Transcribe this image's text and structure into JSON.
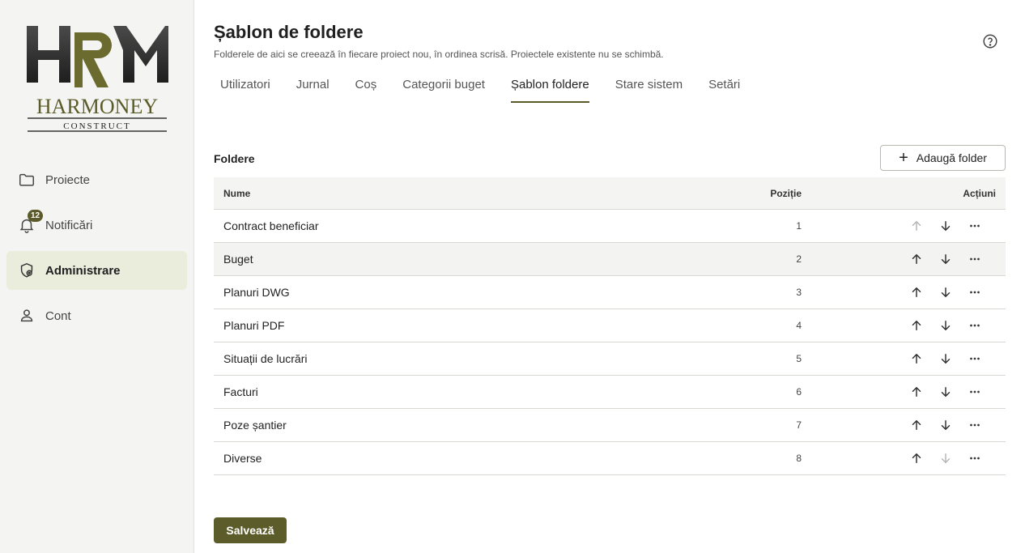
{
  "brand": {
    "logo_text": "HRM",
    "name": "HARMONEY",
    "tagline": "CONSTRUCT",
    "accent_color": "#5c5c2a"
  },
  "sidebar": {
    "items": [
      {
        "label": "Proiecte",
        "icon": "folder-icon",
        "active": false
      },
      {
        "label": "Notificări",
        "icon": "bell-icon",
        "badge": "12",
        "active": false
      },
      {
        "label": "Administrare",
        "icon": "shield-gear-icon",
        "active": true
      },
      {
        "label": "Cont",
        "icon": "user-icon",
        "active": false
      }
    ]
  },
  "header": {
    "title": "Șablon de foldere",
    "subtitle": "Folderele de aici se creează în fiecare proiect nou, în ordinea scrisă. Proiectele existente nu se schimbă.",
    "help_icon": "help-icon"
  },
  "tabs": [
    {
      "label": "Utilizatori",
      "active": false
    },
    {
      "label": "Jurnal",
      "active": false
    },
    {
      "label": "Coș",
      "active": false
    },
    {
      "label": "Categorii buget",
      "active": false
    },
    {
      "label": "Șablon foldere",
      "active": true
    },
    {
      "label": "Stare sistem",
      "active": false
    },
    {
      "label": "Setări",
      "active": false
    }
  ],
  "section": {
    "title": "Foldere",
    "add_button": "Adaugă folder"
  },
  "table": {
    "columns": {
      "name": "Nume",
      "position": "Poziție",
      "actions": "Acțiuni"
    },
    "rows": [
      {
        "name": "Contract beneficiar",
        "position": "1"
      },
      {
        "name": "Buget",
        "position": "2"
      },
      {
        "name": "Planuri DWG",
        "position": "3"
      },
      {
        "name": "Planuri PDF",
        "position": "4"
      },
      {
        "name": "Situații de lucrări",
        "position": "5"
      },
      {
        "name": "Facturi",
        "position": "6"
      },
      {
        "name": "Poze șantier",
        "position": "7"
      },
      {
        "name": "Diverse",
        "position": "8"
      }
    ]
  },
  "footer": {
    "save_button": "Salvează"
  }
}
